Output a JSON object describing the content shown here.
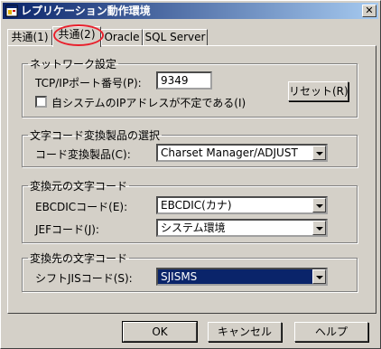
{
  "window": {
    "title": "レプリケーション動作環境",
    "close_glyph": "✕"
  },
  "tabs": [
    {
      "label": "共通(1)"
    },
    {
      "label": "共通(2)",
      "active": true
    },
    {
      "label": "Oracle"
    },
    {
      "label": "SQL Server"
    }
  ],
  "network": {
    "group_label": "ネットワーク設定",
    "port_label": "TCP/IPポート番号(P):",
    "port_value": "9349",
    "ip_check_label": "自システムのIPアドレスが不定である(I)",
    "ip_check_checked": false,
    "reset_label": "リセット(R)"
  },
  "conversion_product": {
    "group_label": "文字コード変換製品の選択",
    "product_label": "コード変換製品(C):",
    "product_value": "Charset Manager/ADJUST"
  },
  "source_code": {
    "group_label": "変換元の文字コード",
    "ebcdic_label": "EBCDICコード(E):",
    "ebcdic_value": "EBCDIC(カナ)",
    "jef_label": "JEFコード(J):",
    "jef_value": "システム環境"
  },
  "target_code": {
    "group_label": "変換先の文字コード",
    "sjis_label": "シフトJISコード(S):",
    "sjis_value": "SJISMS"
  },
  "buttons": {
    "ok": "OK",
    "cancel": "キャンセル",
    "help": "ヘルプ"
  },
  "colors": {
    "titlebar": "#0a246a",
    "face": "#d4d0c8",
    "highlight": "#e8202c"
  },
  "icons": {
    "title": "app-window-icon",
    "dropdown": "dropdown-arrow-icon"
  }
}
